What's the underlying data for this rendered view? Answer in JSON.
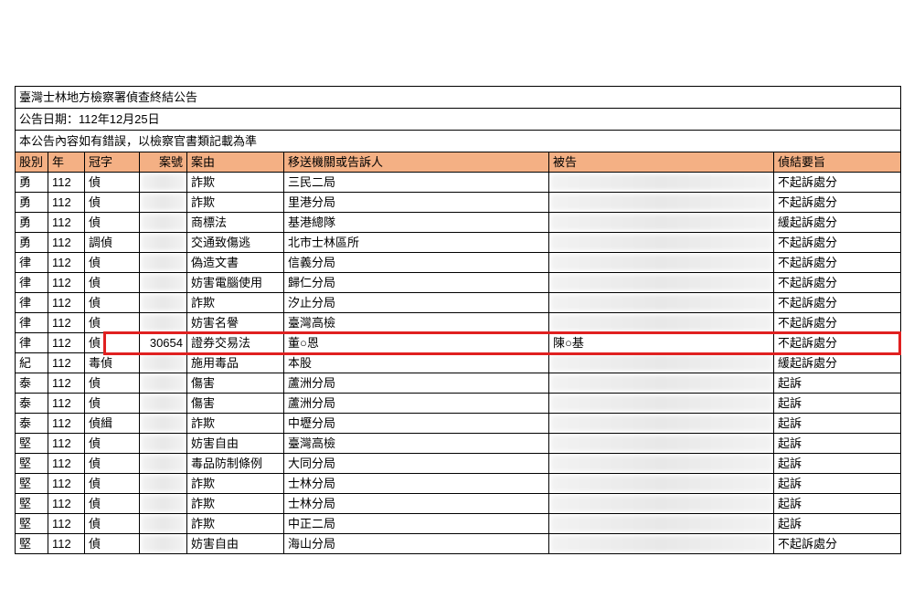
{
  "title": "臺灣士林地方檢察署偵查終結公告",
  "date_line": "公告日期：112年12月25日",
  "note_line": "本公告內容如有錯誤，以檢察官書類記載為準",
  "headers": {
    "gu": "股別",
    "year": "年",
    "guan": "冠字",
    "case_no": "案號",
    "cause": "案由",
    "agency": "移送機關或告訴人",
    "defendant": "被告",
    "result": "偵結要旨"
  },
  "rows": [
    {
      "gu": "勇",
      "year": "112",
      "guan": "偵",
      "case_no": "",
      "cause": "詐欺",
      "agency": "三民二局",
      "defendant": "",
      "result": "不起訴處分",
      "blur_case": true,
      "blur_def": true
    },
    {
      "gu": "勇",
      "year": "112",
      "guan": "偵",
      "case_no": "",
      "cause": "詐欺",
      "agency": "里港分局",
      "defendant": "",
      "result": "不起訴處分",
      "blur_case": true,
      "blur_def": true
    },
    {
      "gu": "勇",
      "year": "112",
      "guan": "偵",
      "case_no": "",
      "cause": "商標法",
      "agency": "基港總隊",
      "defendant": "",
      "result": "緩起訴處分",
      "blur_case": true,
      "blur_def": true
    },
    {
      "gu": "勇",
      "year": "112",
      "guan": "調偵",
      "case_no": "",
      "cause": "交通致傷逃",
      "agency": "北市士林區所",
      "defendant": "",
      "result": "不起訴處分",
      "blur_case": true,
      "blur_def": true
    },
    {
      "gu": "律",
      "year": "112",
      "guan": "偵",
      "case_no": "",
      "cause": "偽造文書",
      "agency": "信義分局",
      "defendant": "",
      "result": "不起訴處分",
      "blur_case": true,
      "blur_def": true
    },
    {
      "gu": "律",
      "year": "112",
      "guan": "偵",
      "case_no": "",
      "cause": "妨害電腦使用",
      "agency": "歸仁分局",
      "defendant": "",
      "result": "不起訴處分",
      "blur_case": true,
      "blur_def": true
    },
    {
      "gu": "律",
      "year": "112",
      "guan": "偵",
      "case_no": "",
      "cause": "詐欺",
      "agency": "汐止分局",
      "defendant": "",
      "result": "不起訴處分",
      "blur_case": true,
      "blur_def": true
    },
    {
      "gu": "律",
      "year": "112",
      "guan": "偵",
      "case_no": "",
      "cause": "妨害名譽",
      "agency": "臺灣高檢",
      "defendant": "",
      "result": "不起訴處分",
      "blur_case": true,
      "blur_def": true
    },
    {
      "gu": "律",
      "year": "112",
      "guan": "偵",
      "case_no": "30654",
      "cause": "證券交易法",
      "agency": "董○恩",
      "defendant": "陳○基",
      "result": "不起訴處分",
      "highlight": true
    },
    {
      "gu": "紀",
      "year": "112",
      "guan": "毒偵",
      "case_no": "",
      "cause": "施用毒品",
      "agency": "本股",
      "defendant": "",
      "result": "緩起訴處分",
      "blur_case": true,
      "blur_def": true
    },
    {
      "gu": "泰",
      "year": "112",
      "guan": "偵",
      "case_no": "",
      "cause": "傷害",
      "agency": "蘆洲分局",
      "defendant": "",
      "result": "起訴",
      "blur_case": true,
      "blur_def": true
    },
    {
      "gu": "泰",
      "year": "112",
      "guan": "偵",
      "case_no": "",
      "cause": "傷害",
      "agency": "蘆洲分局",
      "defendant": "",
      "result": "起訴",
      "blur_case": true,
      "blur_def": true
    },
    {
      "gu": "泰",
      "year": "112",
      "guan": "偵緝",
      "case_no": "",
      "cause": "詐欺",
      "agency": "中壢分局",
      "defendant": "",
      "result": "起訴",
      "blur_case": true,
      "blur_def": true
    },
    {
      "gu": "堅",
      "year": "112",
      "guan": "偵",
      "case_no": "",
      "cause": "妨害自由",
      "agency": "臺灣高檢",
      "defendant": "",
      "result": "起訴",
      "blur_case": true,
      "blur_def": true
    },
    {
      "gu": "堅",
      "year": "112",
      "guan": "偵",
      "case_no": "",
      "cause": "毒品防制條例",
      "agency": "大同分局",
      "defendant": "",
      "result": "起訴",
      "blur_case": true,
      "blur_def": true
    },
    {
      "gu": "堅",
      "year": "112",
      "guan": "偵",
      "case_no": "",
      "cause": "詐欺",
      "agency": "士林分局",
      "defendant": "",
      "result": "起訴",
      "blur_case": true,
      "blur_def": true
    },
    {
      "gu": "堅",
      "year": "112",
      "guan": "偵",
      "case_no": "",
      "cause": "詐欺",
      "agency": "士林分局",
      "defendant": "",
      "result": "起訴",
      "blur_case": true,
      "blur_def": true
    },
    {
      "gu": "堅",
      "year": "112",
      "guan": "偵",
      "case_no": "",
      "cause": "詐欺",
      "agency": "中正二局",
      "defendant": "",
      "result": "起訴",
      "blur_case": true,
      "blur_def": true
    },
    {
      "gu": "堅",
      "year": "112",
      "guan": "偵",
      "case_no": "",
      "cause": "妨害自由",
      "agency": "海山分局",
      "defendant": "",
      "result": "不起訴處分",
      "blur_case": true,
      "blur_def": true
    }
  ]
}
